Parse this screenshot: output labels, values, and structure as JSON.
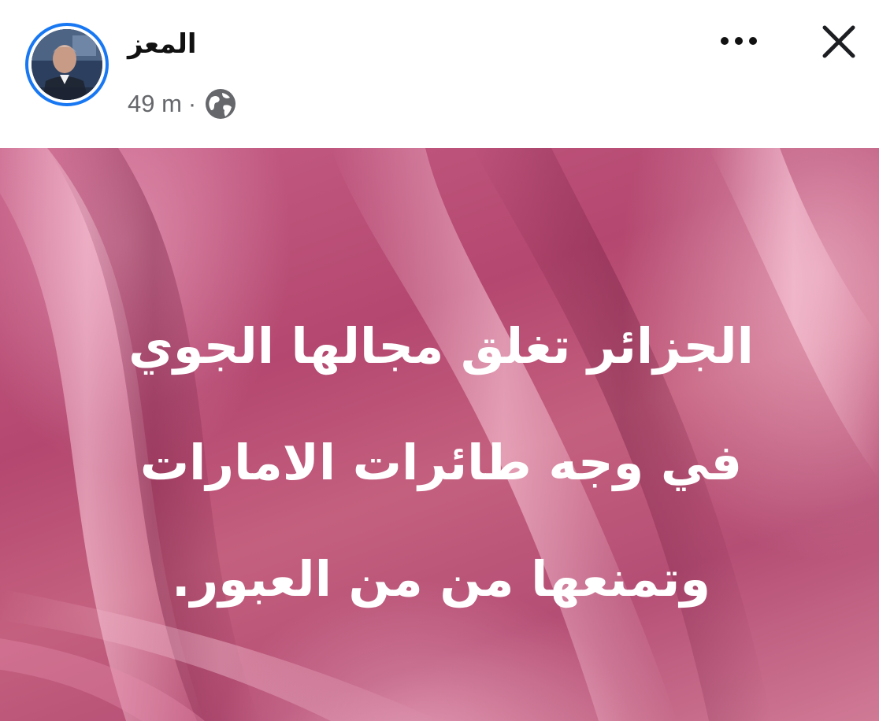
{
  "post": {
    "author": {
      "name": "المعز",
      "avatar_icon": "profile-photo"
    },
    "time": "49 m",
    "separator": "·",
    "audience_icon": "globe-icon",
    "more_icon": "more-dots-icon",
    "close_icon": "close-icon",
    "text_lines": [
      "الجزائر تغلق مجالها الجوي",
      "في وجه طائرات الامارات",
      "وتمنعها من  من العبور."
    ]
  },
  "colors": {
    "avatar_ring": "#1877f2",
    "meta_text": "#65676b",
    "background_pink": "#b4476f",
    "post_text": "#ffffff"
  }
}
